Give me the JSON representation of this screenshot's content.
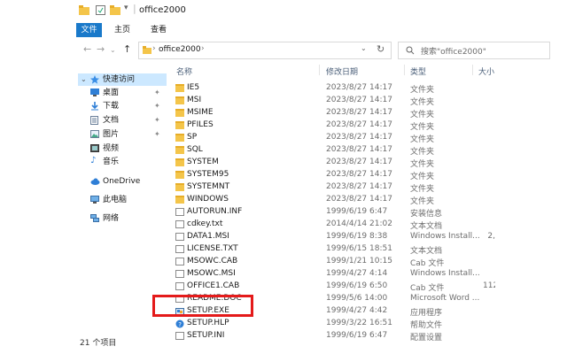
{
  "window": {
    "title": "office2000"
  },
  "ribbon": {
    "tabs": [
      "文件",
      "主页",
      "查看"
    ]
  },
  "address": {
    "path": "office2000",
    "search_placeholder": "搜索\"office2000\""
  },
  "nav": {
    "quick_access": "快速访问",
    "items": [
      {
        "label": "桌面",
        "icon": "desktop-icon",
        "pinned": true
      },
      {
        "label": "下载",
        "icon": "download-icon",
        "pinned": true
      },
      {
        "label": "文档",
        "icon": "documents-icon",
        "pinned": true
      },
      {
        "label": "图片",
        "icon": "pictures-icon",
        "pinned": true
      },
      {
        "label": "视频",
        "icon": "videos-icon",
        "pinned": false
      },
      {
        "label": "音乐",
        "icon": "music-icon",
        "pinned": false
      }
    ],
    "onedrive": "OneDrive",
    "this_pc": "此电脑",
    "network": "网络"
  },
  "columns": {
    "name": "名称",
    "modified": "修改日期",
    "type": "类型",
    "size": "大小"
  },
  "files": [
    {
      "name": "IE5",
      "date": "2023/8/27 14:17",
      "type": "文件夹",
      "size": "",
      "kind": "folder"
    },
    {
      "name": "MSI",
      "date": "2023/8/27 14:17",
      "type": "文件夹",
      "size": "",
      "kind": "folder"
    },
    {
      "name": "MSIME",
      "date": "2023/8/27 14:17",
      "type": "文件夹",
      "size": "",
      "kind": "folder"
    },
    {
      "name": "PFILES",
      "date": "2023/8/27 14:17",
      "type": "文件夹",
      "size": "",
      "kind": "folder"
    },
    {
      "name": "SP",
      "date": "2023/8/27 14:17",
      "type": "文件夹",
      "size": "",
      "kind": "folder"
    },
    {
      "name": "SQL",
      "date": "2023/8/27 14:17",
      "type": "文件夹",
      "size": "",
      "kind": "folder"
    },
    {
      "name": "SYSTEM",
      "date": "2023/8/27 14:17",
      "type": "文件夹",
      "size": "",
      "kind": "folder"
    },
    {
      "name": "SYSTEM95",
      "date": "2023/8/27 14:17",
      "type": "文件夹",
      "size": "",
      "kind": "folder"
    },
    {
      "name": "SYSTEMNT",
      "date": "2023/8/27 14:17",
      "type": "文件夹",
      "size": "",
      "kind": "folder"
    },
    {
      "name": "WINDOWS",
      "date": "2023/8/27 14:17",
      "type": "文件夹",
      "size": "",
      "kind": "folder"
    },
    {
      "name": "AUTORUN.INF",
      "date": "1999/6/19 6:47",
      "type": "安装信息",
      "size": "",
      "kind": "file"
    },
    {
      "name": "cdkey.txt",
      "date": "2014/4/14 21:02",
      "type": "文本文档",
      "size": "",
      "kind": "file"
    },
    {
      "name": "DATA1.MSI",
      "date": "1999/6/19 8:38",
      "type": "Windows Install...",
      "size": "2,",
      "kind": "file"
    },
    {
      "name": "LICENSE.TXT",
      "date": "1999/6/15 18:51",
      "type": "文本文档",
      "size": "",
      "kind": "file"
    },
    {
      "name": "MSOWC.CAB",
      "date": "1999/1/21 10:15",
      "type": "Cab 文件",
      "size": "",
      "kind": "file"
    },
    {
      "name": "MSOWC.MSI",
      "date": "1999/4/27 4:14",
      "type": "Windows Install...",
      "size": "",
      "kind": "file"
    },
    {
      "name": "OFFICE1.CAB",
      "date": "1999/6/19 6:50",
      "type": "Cab 文件",
      "size": "112,",
      "kind": "file"
    },
    {
      "name": "README.DOC",
      "date": "1999/5/6 14:00",
      "type": "Microsoft Word ...",
      "size": "",
      "kind": "file"
    },
    {
      "name": "SETUP.EXE",
      "date": "1999/4/27 4:42",
      "type": "应用程序",
      "size": "",
      "kind": "exe"
    },
    {
      "name": "SETUP.HLP",
      "date": "1999/3/22 16:51",
      "type": "帮助文件",
      "size": "",
      "kind": "help"
    },
    {
      "name": "SETUP.INI",
      "date": "1999/6/19 6:47",
      "type": "配置设置",
      "size": "",
      "kind": "file"
    }
  ],
  "status": {
    "count": "21 个项目"
  },
  "colors": {
    "accent": "#1979ca",
    "highlight": "#e41a1a",
    "selected_nav": "#cce8ff",
    "folder": "#f4c54a"
  }
}
